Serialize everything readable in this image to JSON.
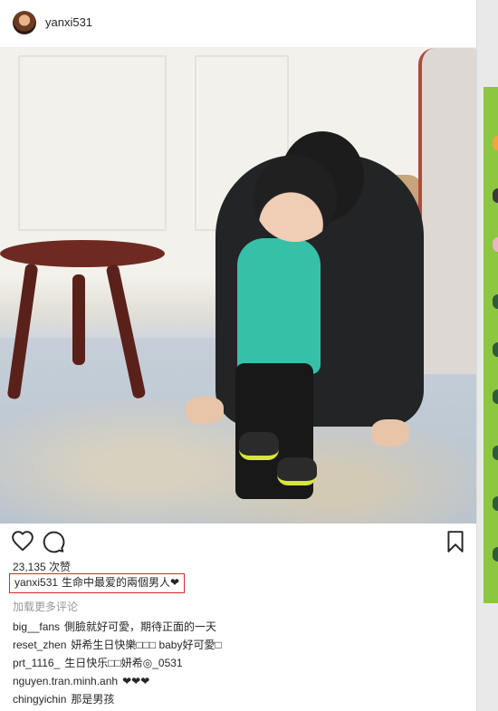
{
  "post": {
    "username": "yanxi531",
    "likes": "23,135 次赞",
    "caption_user": "yanxi531",
    "caption_text": "生命中最爱的兩個男人❤",
    "load_more": "加载更多评论"
  },
  "comments": [
    {
      "user": "big__fans",
      "text": "側臉就好可愛，期待正面的一天"
    },
    {
      "user": "reset_zhen",
      "text": "妍希生日快樂□□□ baby好可愛□"
    },
    {
      "user": "prt_1116_",
      "text": "生日快乐□□妍希◎_0531"
    },
    {
      "user": "nguyen.tran.minh.anh",
      "text": "❤❤❤"
    },
    {
      "user": "chingyichin",
      "text": "那是男孩"
    }
  ],
  "icons": {
    "like": "heart-outline-icon",
    "comment": "speech-bubble-icon",
    "save": "bookmark-icon"
  },
  "colors": {
    "highlight_border": "#d62828",
    "side_strip": "#8dc63f"
  }
}
